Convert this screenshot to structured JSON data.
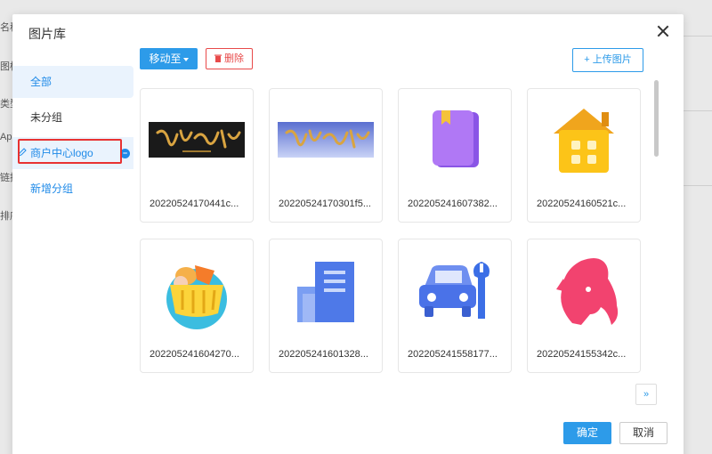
{
  "background": {
    "labels": [
      "名称",
      "图标",
      "类型",
      "App",
      "链接",
      "排序"
    ]
  },
  "modal": {
    "title": "图片库",
    "close_icon": "close-icon"
  },
  "sidebar": {
    "items": [
      {
        "label": "全部"
      },
      {
        "label": "未分组"
      },
      {
        "label": "商户中心logo"
      },
      {
        "label": "新增分组"
      }
    ]
  },
  "toolbar": {
    "move_label": "移动至",
    "delete_label": "删除",
    "upload_label": "+ 上传图片"
  },
  "images": [
    {
      "name": "20220524170441c...",
      "icon": "calligraphy-logo-dark"
    },
    {
      "name": "20220524170301f5...",
      "icon": "calligraphy-logo-blue"
    },
    {
      "name": "20220524160738​2...",
      "icon": "book-icon"
    },
    {
      "name": "20220524160521c...",
      "icon": "house-icon"
    },
    {
      "name": "20220524160427​0...",
      "icon": "shopping-basket-icon"
    },
    {
      "name": "20220524160132​8...",
      "icon": "building-icon"
    },
    {
      "name": "20220524155817​7...",
      "icon": "car-repair-icon"
    },
    {
      "name": "20220524155342c...",
      "icon": "woman-profile-icon"
    }
  ],
  "pagination": {
    "next_label": "»"
  },
  "footer": {
    "ok_label": "确定",
    "cancel_label": "取消"
  },
  "colors": {
    "accent": "#2d9be9",
    "danger": "#e84a4a",
    "highlight_box": "#e83232"
  }
}
